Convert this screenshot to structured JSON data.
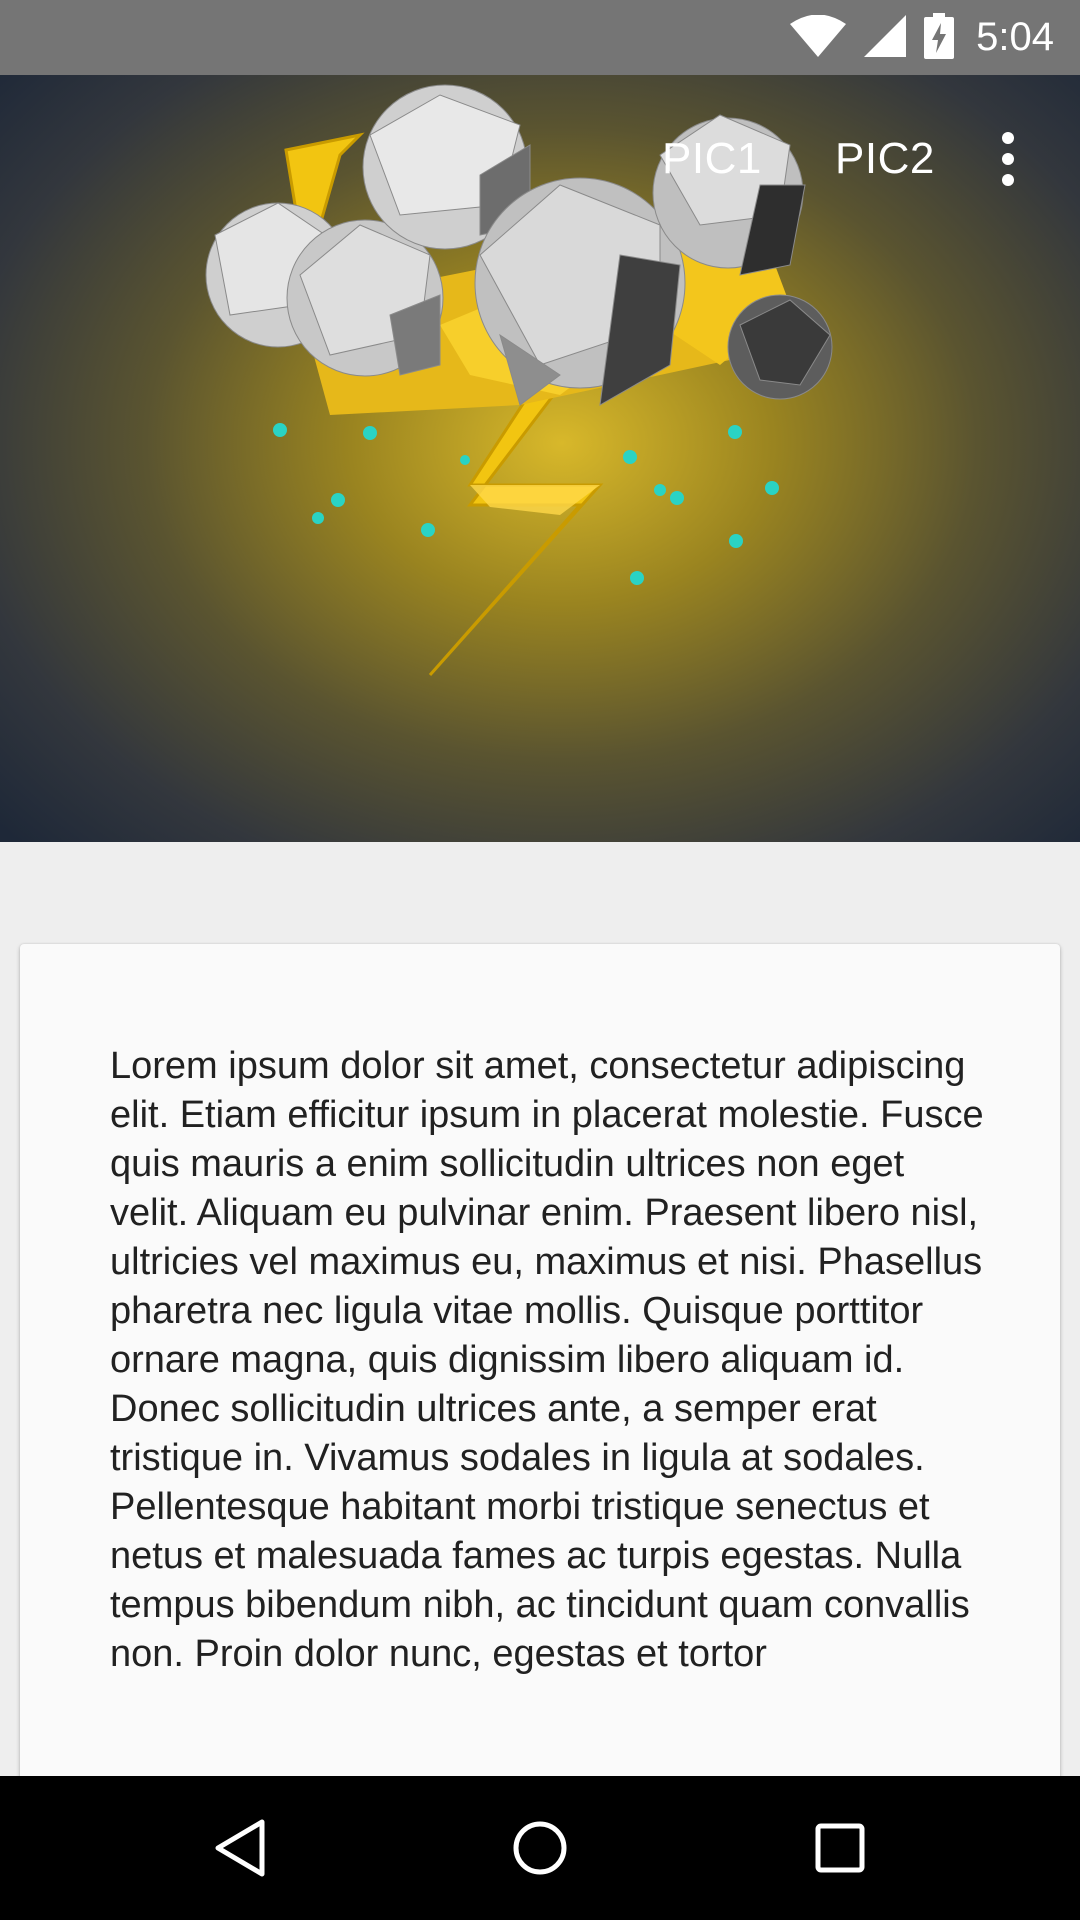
{
  "status_bar": {
    "time": "5:04",
    "icons": [
      "wifi-icon",
      "cell-signal-icon",
      "battery-charging-icon"
    ]
  },
  "toolbar": {
    "actions": [
      {
        "label": "PIC1"
      },
      {
        "label": "PIC2"
      }
    ],
    "overflow_icon": "more-vert-icon"
  },
  "header_image": {
    "subject": "low-poly storm cloud with lightning bolt and rain drops",
    "accent_color": "#f2c511"
  },
  "card": {
    "body_text": "Lorem ipsum dolor sit amet, consectetur adipiscing elit. Etiam efficitur ipsum in placerat molestie. Fusce quis mauris a enim sollicitudin ultrices non eget velit. Aliquam eu pulvinar enim. Praesent libero nisl, ultricies vel maximus eu, maximus et nisi. Phasellus pharetra nec ligula vitae mollis. Quisque porttitor ornare magna, quis dignissim libero aliquam id. Donec sollicitudin ultrices ante, a semper erat tristique in. Vivamus sodales in ligula at sodales. Pellentesque habitant morbi tristique senectus et netus et malesuada fames ac turpis egestas. Nulla tempus bibendum nibh, ac tincidunt quam convallis non. Proin dolor nunc, egestas et tortor"
  },
  "nav_bar": {
    "buttons": [
      "back-icon",
      "home-icon",
      "recents-icon"
    ]
  }
}
